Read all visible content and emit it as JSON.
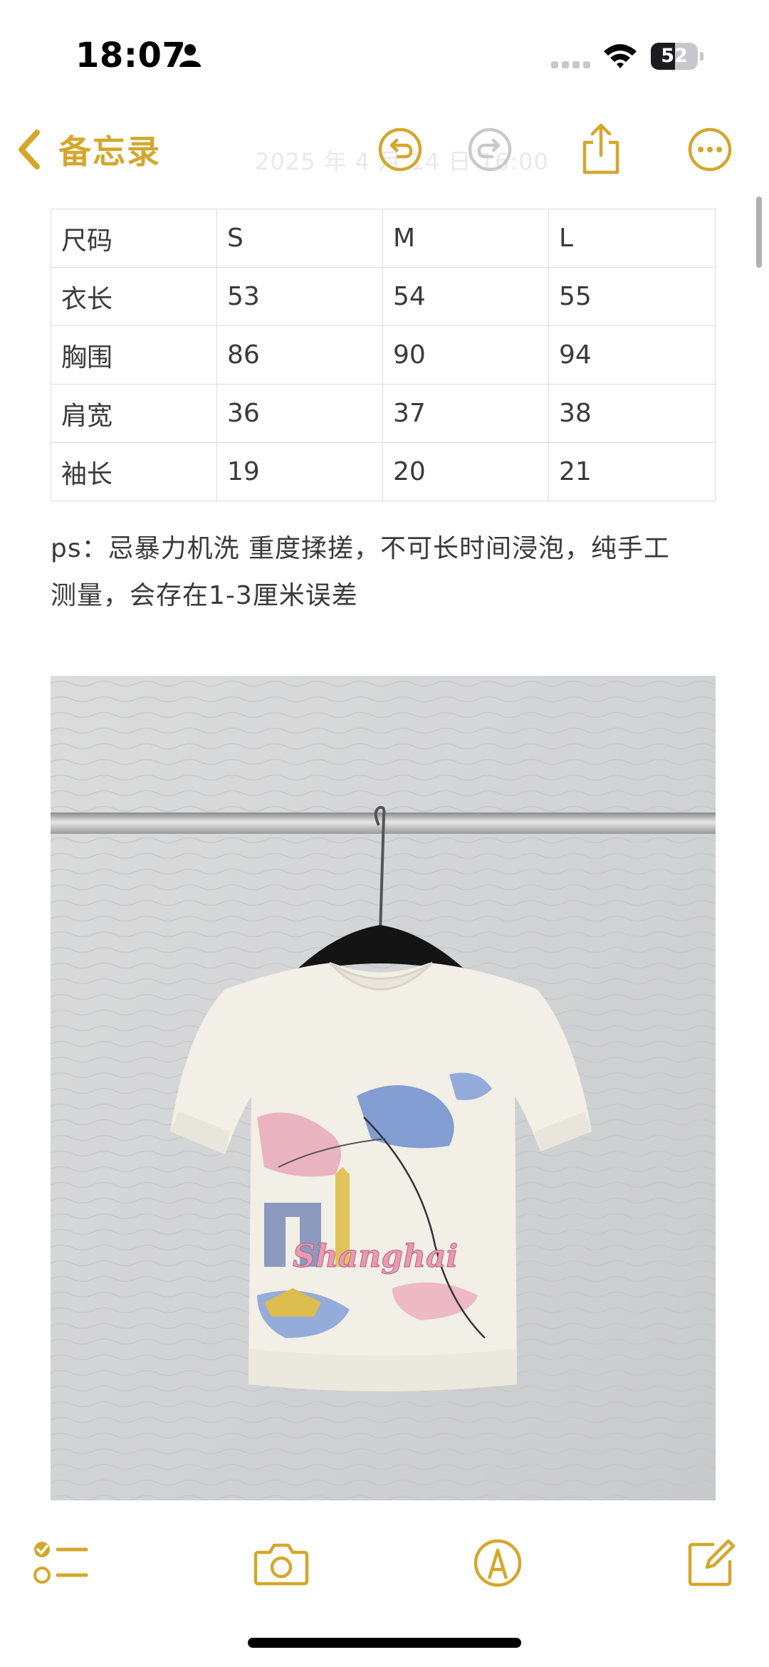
{
  "status_bar": {
    "time": "18:07",
    "battery_level": "52",
    "battery_fraction": 0.52
  },
  "nav": {
    "back_label": "备忘录",
    "faded_title": "2025 年 4 月 14 日 16:00",
    "icons": [
      "undo-icon",
      "redo-icon",
      "share-icon",
      "more-icon"
    ]
  },
  "size_table": {
    "rows": [
      [
        "尺码",
        "S",
        "M",
        "L"
      ],
      [
        "衣长",
        "53",
        "54",
        "55"
      ],
      [
        "胸围",
        "86",
        "90",
        "94"
      ],
      [
        "肩宽",
        "36",
        "37",
        "38"
      ],
      [
        "袖长",
        "19",
        "20",
        "21"
      ]
    ]
  },
  "note": {
    "line1": "ps：忌暴力机洗 重度揉搓，不可长时间浸泡，纯手工",
    "line2": "测量，会存在1-3厘米误差"
  },
  "photo": {
    "print_text": "Shanghai"
  },
  "toolbar": {
    "icons": [
      "checklist-icon",
      "camera-icon",
      "markup-icon",
      "compose-icon"
    ]
  },
  "colors": {
    "accent": "#d4a72c",
    "accent_disabled": "#c9c9cc"
  }
}
